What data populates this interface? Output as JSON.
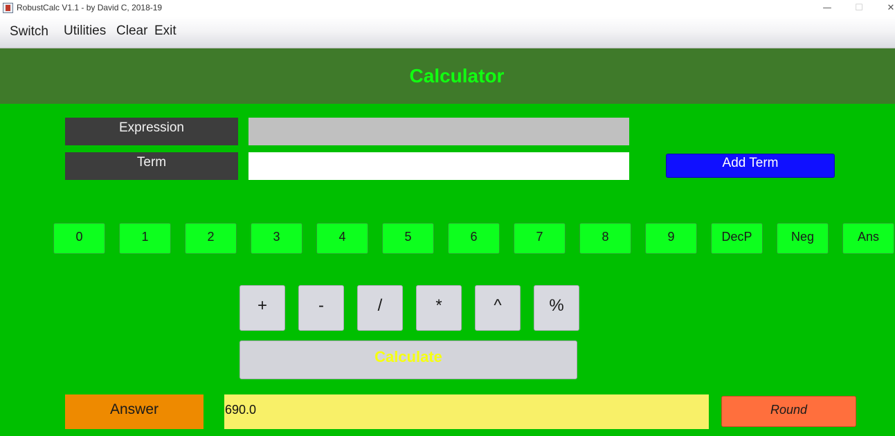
{
  "window": {
    "title": "RobustCalc V1.1 - by David C, 2018-19",
    "icon": "java-app-icon",
    "controls": {
      "minimize": "—",
      "maximize": "☐",
      "close": "✕"
    }
  },
  "menu": [
    "Switch",
    "Utilities",
    "Clear",
    "Exit"
  ],
  "header": {
    "title": "Calculator"
  },
  "form": {
    "expression_label": "Expression",
    "expression_value": "",
    "term_label": "Term",
    "term_value": "",
    "add_term_label": "Add Term"
  },
  "keypad": {
    "digits": [
      "0",
      "1",
      "2",
      "3",
      "4",
      "5",
      "6",
      "7",
      "8",
      "9",
      "DecP",
      "Neg",
      "Ans"
    ],
    "operators": [
      "+",
      "-",
      "/",
      "*",
      "^",
      "%"
    ],
    "calculate_label": "Calculate"
  },
  "answer": {
    "label": "Answer",
    "value": "690.0",
    "round_label": "Round"
  },
  "colors": {
    "background": "#00bf00",
    "header": "#3f7a2a",
    "header_text": "#11ff11",
    "label_bg": "#3d3d3d",
    "add_term_bg": "#1010ff",
    "digit_bg": "#0dff1e",
    "operator_bg": "#d8d9e0",
    "calculate_text": "#f6ff10",
    "answer_label_bg": "#ee8a00",
    "answer_field_bg": "#f8f068",
    "round_bg": "#ff6f3d"
  }
}
